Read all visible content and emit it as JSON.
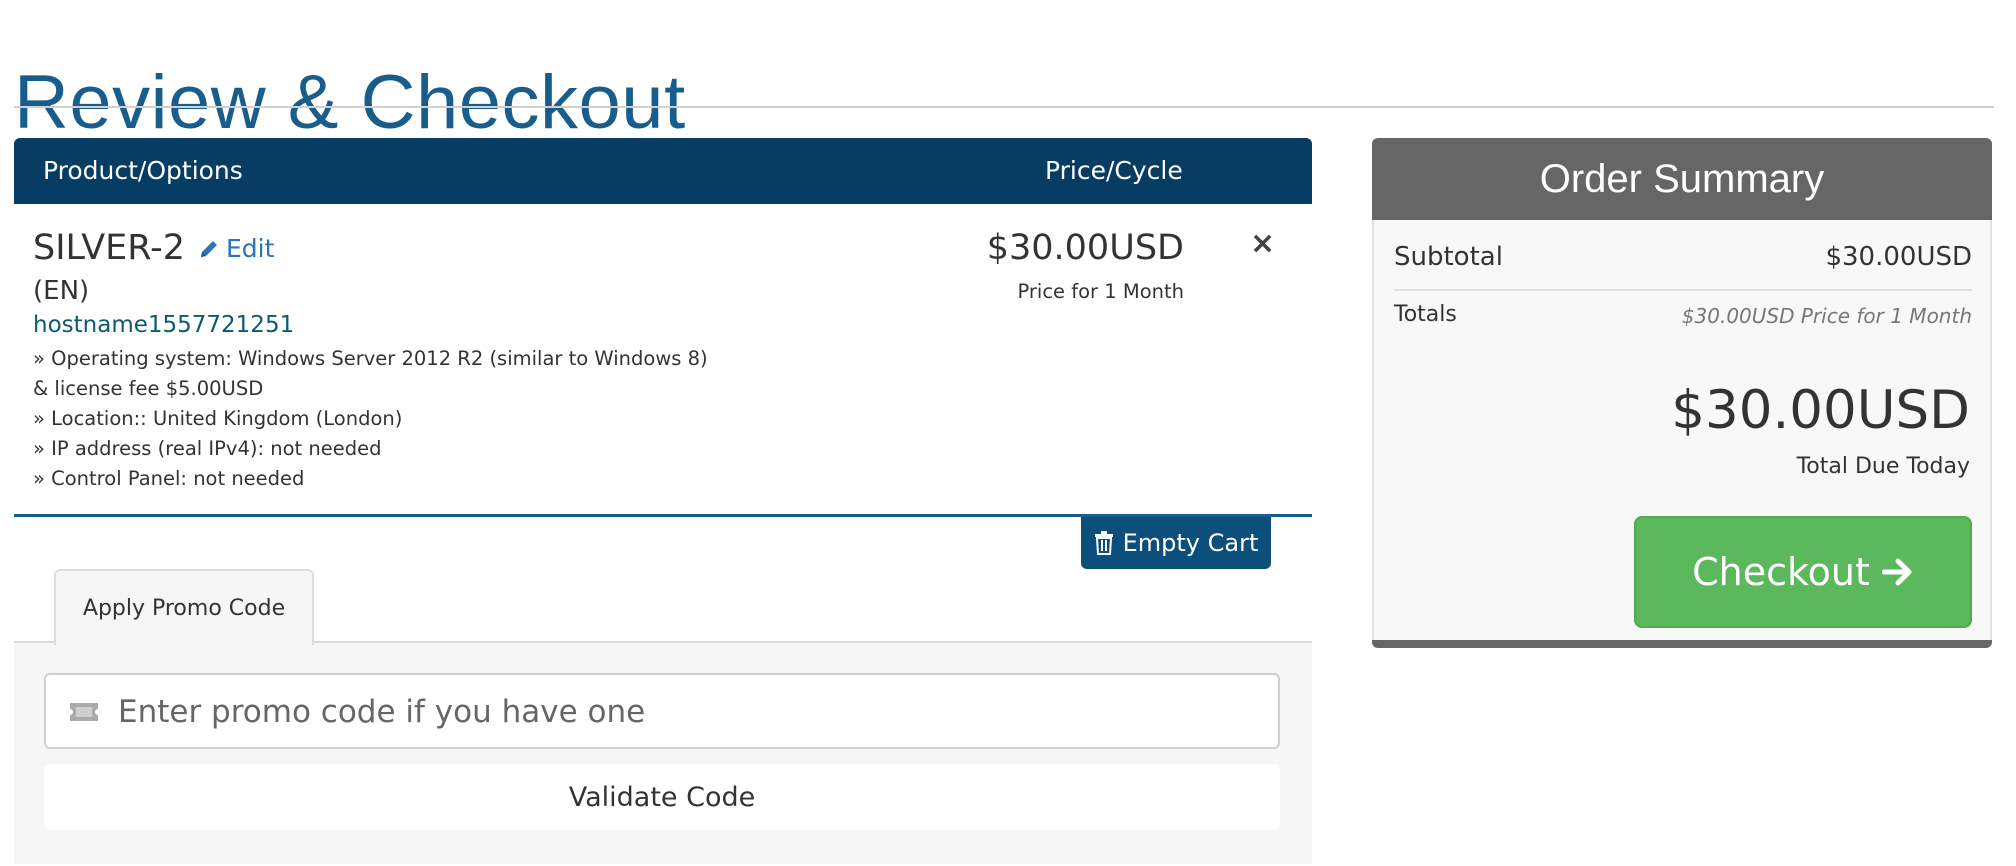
{
  "page": {
    "title": "Review & Checkout"
  },
  "cart": {
    "headers": {
      "product": "Product/Options",
      "price": "Price/Cycle"
    },
    "item": {
      "name": "SILVER-2",
      "edit_label": "Edit",
      "lang": "(EN)",
      "hostname": "hostname1557721251",
      "options": [
        " » Operating system: Windows Server 2012 R2 (similar to Windows 8) & license fee $5.00USD",
        " » Location:: United Kingdom (London)",
        " » IP address (real IPv4): not needed",
        " » Control Panel: not needed"
      ],
      "price": "$30.00USD",
      "cycle": "Price for 1 Month",
      "remove_symbol": "×"
    },
    "empty_cart_label": "Empty Cart"
  },
  "promo": {
    "tab_label": "Apply Promo Code",
    "placeholder": "Enter promo code if you have one",
    "validate_label": "Validate Code"
  },
  "summary": {
    "title": "Order Summary",
    "subtotal_label": "Subtotal",
    "subtotal_value": "$30.00USD",
    "totals_label": "Totals",
    "totals_value": "$30.00USD Price for 1 Month",
    "total_due": "$30.00USD",
    "total_due_label": "Total Due Today",
    "checkout_label": "Checkout"
  },
  "colors": {
    "title": "#185d8c",
    "table_header": "#073d63",
    "summary_header": "#666666",
    "checkout": "#5cb85c",
    "link": "#2a74b7"
  },
  "icons": [
    "pencil-icon",
    "close-icon",
    "trash-icon",
    "ticket-icon",
    "arrow-right-icon"
  ]
}
